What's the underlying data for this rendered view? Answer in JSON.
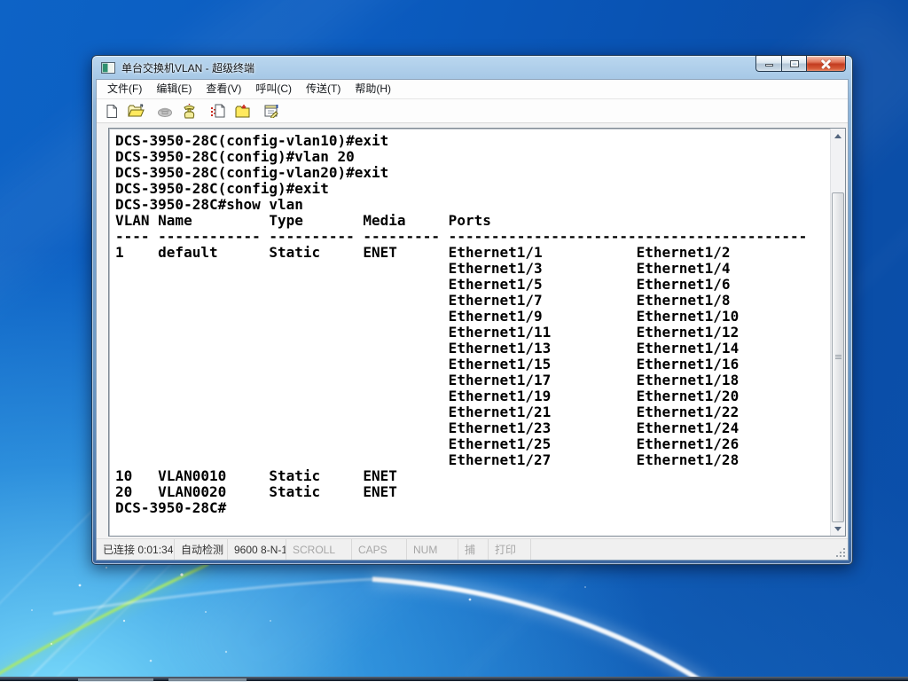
{
  "window": {
    "title": "单台交换机VLAN - 超级终端",
    "controls": {
      "minimize": "minimize",
      "maximize": "maximize",
      "close": "close"
    }
  },
  "menu": {
    "items": [
      {
        "label": "文件(F)"
      },
      {
        "label": "编辑(E)"
      },
      {
        "label": "查看(V)"
      },
      {
        "label": "呼叫(C)"
      },
      {
        "label": "传送(T)"
      },
      {
        "label": "帮助(H)"
      }
    ]
  },
  "toolbar": {
    "icons": [
      "new-file",
      "open-file",
      "call",
      "hang-up",
      "send-file",
      "receive-file",
      "properties"
    ]
  },
  "terminal": {
    "lines": [
      "DCS-3950-28C(config-vlan10)#exit",
      "DCS-3950-28C(config)#vlan 20",
      "DCS-3950-28C(config-vlan20)#exit",
      "DCS-3950-28C(config)#exit",
      "DCS-3950-28C#show vlan",
      "VLAN Name         Type       Media     Ports",
      "---- ------------ ---------- --------- ------------------------------------------",
      "1    default      Static     ENET      Ethernet1/1           Ethernet1/2",
      "                                       Ethernet1/3           Ethernet1/4",
      "                                       Ethernet1/5           Ethernet1/6",
      "                                       Ethernet1/7           Ethernet1/8",
      "                                       Ethernet1/9           Ethernet1/10",
      "                                       Ethernet1/11          Ethernet1/12",
      "                                       Ethernet1/13          Ethernet1/14",
      "                                       Ethernet1/15          Ethernet1/16",
      "                                       Ethernet1/17          Ethernet1/18",
      "                                       Ethernet1/19          Ethernet1/20",
      "                                       Ethernet1/21          Ethernet1/22",
      "                                       Ethernet1/23          Ethernet1/24",
      "                                       Ethernet1/25          Ethernet1/26",
      "                                       Ethernet1/27          Ethernet1/28",
      "10   VLAN0010     Static     ENET",
      "20   VLAN0020     Static     ENET",
      "DCS-3950-28C#"
    ],
    "vlan_table": {
      "headers": [
        "VLAN",
        "Name",
        "Type",
        "Media",
        "Ports"
      ],
      "rows": [
        {
          "vlan": "1",
          "name": "default",
          "type": "Static",
          "media": "ENET",
          "ports": [
            "Ethernet1/1",
            "Ethernet1/2",
            "Ethernet1/3",
            "Ethernet1/4",
            "Ethernet1/5",
            "Ethernet1/6",
            "Ethernet1/7",
            "Ethernet1/8",
            "Ethernet1/9",
            "Ethernet1/10",
            "Ethernet1/11",
            "Ethernet1/12",
            "Ethernet1/13",
            "Ethernet1/14",
            "Ethernet1/15",
            "Ethernet1/16",
            "Ethernet1/17",
            "Ethernet1/18",
            "Ethernet1/19",
            "Ethernet1/20",
            "Ethernet1/21",
            "Ethernet1/22",
            "Ethernet1/23",
            "Ethernet1/24",
            "Ethernet1/25",
            "Ethernet1/26",
            "Ethernet1/27",
            "Ethernet1/28"
          ]
        },
        {
          "vlan": "10",
          "name": "VLAN0010",
          "type": "Static",
          "media": "ENET",
          "ports": []
        },
        {
          "vlan": "20",
          "name": "VLAN0020",
          "type": "Static",
          "media": "ENET",
          "ports": []
        }
      ]
    },
    "prompt": "DCS-3950-28C#"
  },
  "statusbar": {
    "segments": [
      {
        "label": "已连接 0:01:34",
        "enabled": true
      },
      {
        "label": "自动检测",
        "enabled": true
      },
      {
        "label": "9600 8-N-1",
        "enabled": true
      },
      {
        "label": "SCROLL",
        "enabled": false
      },
      {
        "label": "CAPS",
        "enabled": false
      },
      {
        "label": "NUM",
        "enabled": false
      },
      {
        "label": "捕",
        "enabled": false
      },
      {
        "label": "打印",
        "enabled": false
      }
    ]
  },
  "colors": {
    "desktop_blue": "#0a58b8",
    "desktop_cyan_glow": "#67dcff",
    "green_streak": "#9be060",
    "aero_frame": "#7aa5cf",
    "close_button_red": "#c33c20",
    "terminal_bg": "#ffffff",
    "terminal_text": "#000000",
    "statusbar_bg": "#f0f0f0"
  }
}
